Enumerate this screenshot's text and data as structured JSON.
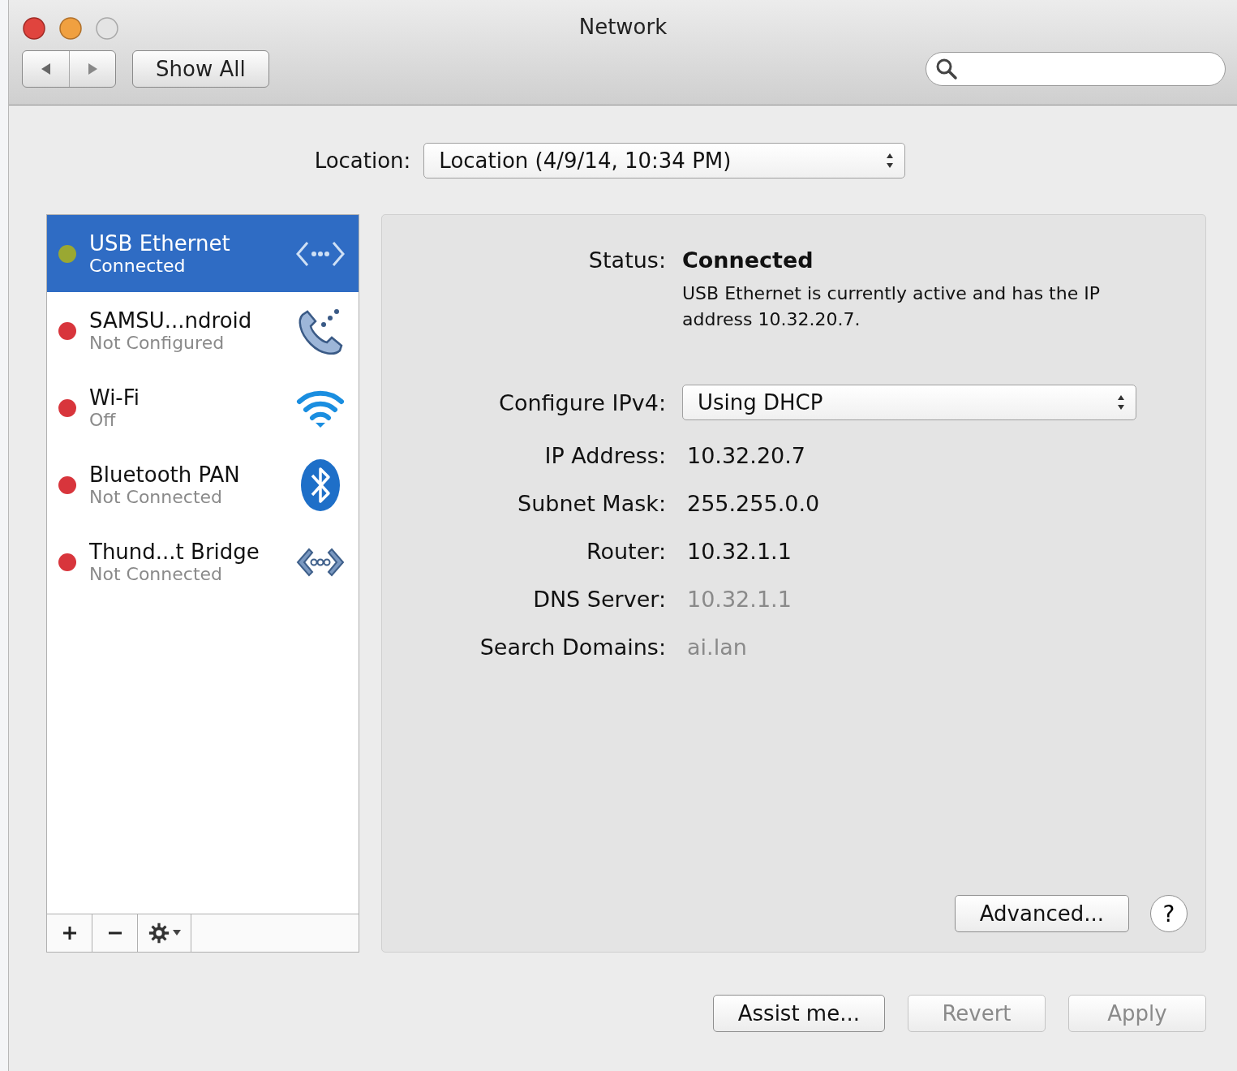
{
  "window": {
    "title": "Network"
  },
  "toolbar": {
    "show_all": "Show All"
  },
  "location": {
    "label": "Location:",
    "value": "Location (4/9/14, 10:34 PM)"
  },
  "services": [
    {
      "name": "USB Ethernet",
      "status": "Connected",
      "color": "#9aa832",
      "kind": "ethernet",
      "selected": true
    },
    {
      "name": "SAMSU...ndroid",
      "status": "Not Configured",
      "color": "#d8353c",
      "kind": "phone",
      "selected": false
    },
    {
      "name": "Wi-Fi",
      "status": "Off",
      "color": "#d8353c",
      "kind": "wifi",
      "selected": false
    },
    {
      "name": "Bluetooth PAN",
      "status": "Not Connected",
      "color": "#d8353c",
      "kind": "bluetooth",
      "selected": false
    },
    {
      "name": "Thund...t Bridge",
      "status": "Not Connected",
      "color": "#d8353c",
      "kind": "bridge",
      "selected": false
    }
  ],
  "status": {
    "label": "Status:",
    "value": "Connected",
    "description": "USB Ethernet is currently active and has the IP address 10.32.20.7."
  },
  "details": [
    {
      "kind": "popup",
      "label": "Configure IPv4:",
      "value": "Using DHCP"
    },
    {
      "kind": "text",
      "label": "IP Address:",
      "value": "10.32.20.7"
    },
    {
      "kind": "text",
      "label": "Subnet Mask:",
      "value": "255.255.0.0"
    },
    {
      "kind": "text",
      "label": "Router:",
      "value": "10.32.1.1"
    },
    {
      "kind": "dimtext",
      "label": "DNS Server:",
      "value": "10.32.1.1"
    },
    {
      "kind": "dimtext",
      "label": "Search Domains:",
      "value": "ai.lan"
    }
  ],
  "advanced_button": "Advanced...",
  "help_button": "?",
  "footer_buttons": [
    {
      "label": "Assist me...",
      "disabled": false
    },
    {
      "label": "Revert",
      "disabled": true
    },
    {
      "label": "Apply",
      "disabled": true
    }
  ]
}
